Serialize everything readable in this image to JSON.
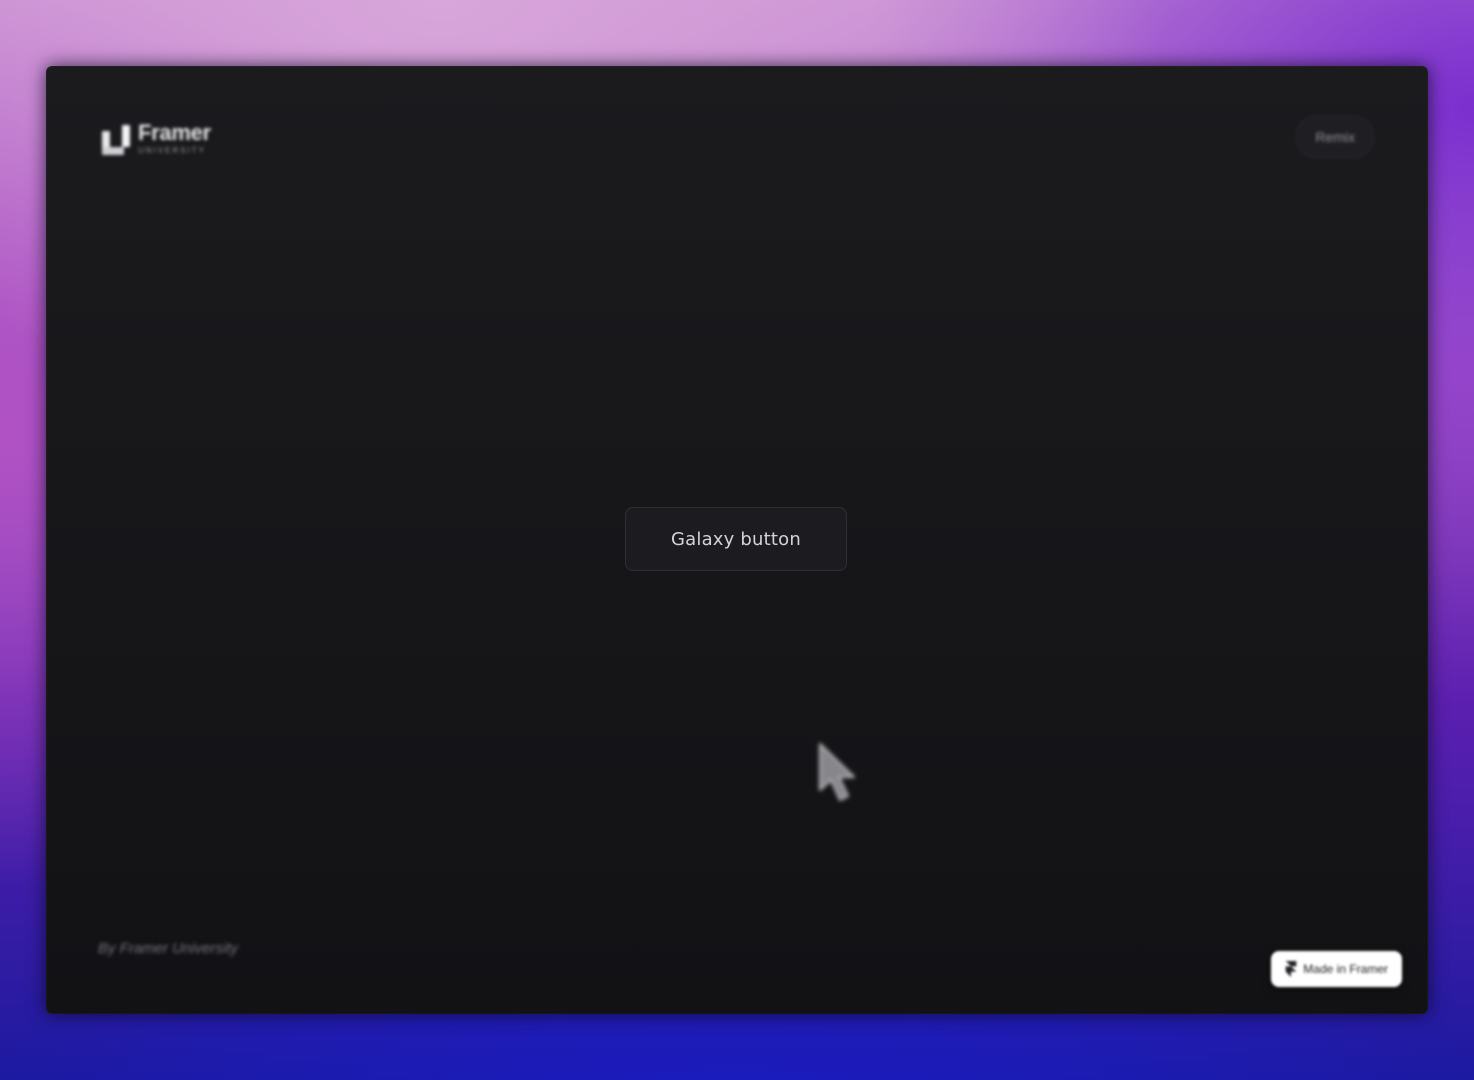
{
  "brand": {
    "name": "Framer",
    "subtitle": "UNIVERSITY"
  },
  "header": {
    "pill_label": "Remix"
  },
  "main": {
    "button_label": "Galaxy button"
  },
  "footer": {
    "credit": "By Framer University",
    "badge_label": "Made in Framer"
  },
  "colors": {
    "frame_bg": "#17171a",
    "button_bg": "#1c1c20",
    "button_text": "#d4d4d8"
  }
}
